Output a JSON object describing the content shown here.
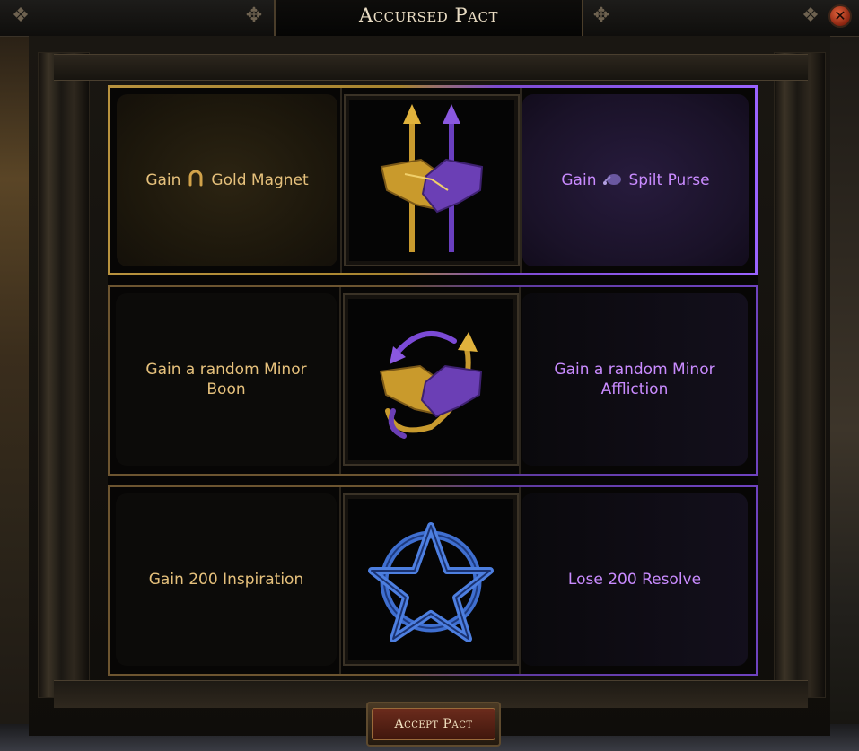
{
  "window": {
    "title": "Accursed Pact",
    "close_icon": "close-icon"
  },
  "pacts": [
    {
      "gain": {
        "prefix": "Gain",
        "icon": "horseshoe-icon",
        "text": "Gold Magnet"
      },
      "center_icon": "gold-purple-handshake-spears-icon",
      "lose": {
        "prefix": "Gain",
        "icon": "spilt-purse-icon",
        "text": "Spilt Purse"
      },
      "selected": true
    },
    {
      "gain": {
        "text": "Gain a random Minor Boon"
      },
      "center_icon": "handshake-swirl-arrows-icon",
      "lose": {
        "text": "Gain a random Minor Affliction"
      },
      "selected": false
    },
    {
      "gain": {
        "text": "Gain 200 Inspiration"
      },
      "center_icon": "blue-pentagram-icon",
      "lose": {
        "text": "Lose 200 Resolve"
      },
      "selected": false
    }
  ],
  "accept_button": {
    "label": "Accept Pact"
  },
  "colors": {
    "gain_text": "#e6c17c",
    "lose_text": "#c98bff",
    "selected_gold": "#b8923e",
    "selected_purple": "#9a63ff"
  }
}
